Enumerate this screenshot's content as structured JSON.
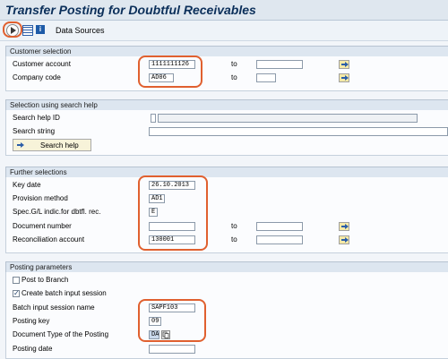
{
  "window": {
    "title": "Transfer Posting for Doubtful Receivables"
  },
  "toolbar": {
    "data_sources_label": "Data Sources"
  },
  "customer_selection": {
    "header": "Customer selection",
    "customer_account": {
      "label": "Customer account",
      "value": "1111111126",
      "to_label": "to",
      "to_value": ""
    },
    "company_code": {
      "label": "Company code",
      "value": "AD06",
      "to_label": "to",
      "to_value": ""
    }
  },
  "search_help": {
    "header": "Selection using search help",
    "search_help_id": {
      "label": "Search help ID",
      "value": ""
    },
    "search_string": {
      "label": "Search string",
      "value": ""
    },
    "button_label": "Search help"
  },
  "further_selections": {
    "header": "Further selections",
    "key_date": {
      "label": "Key date",
      "value": "26.10.2013"
    },
    "provision_method": {
      "label": "Provision method",
      "value": "AD1"
    },
    "special_gl": {
      "label": "Spec.G/L indic.for dbtfl. rec.",
      "value": "E"
    },
    "document_number": {
      "label": "Document number",
      "value": "",
      "to_label": "to",
      "to_value": ""
    },
    "reconciliation_account": {
      "label": "Reconciliation account",
      "value": "130001",
      "to_label": "to",
      "to_value": ""
    }
  },
  "posting_parameters": {
    "header": "Posting parameters",
    "post_to_branch": {
      "label": "Post to Branch",
      "checked": false
    },
    "create_batch_input": {
      "label": "Create batch input session",
      "checked": true
    },
    "batch_session_name": {
      "label": "Batch input session name",
      "value": "SAPF103"
    },
    "posting_key": {
      "label": "Posting key",
      "value": "09"
    },
    "document_type": {
      "label": "Document Type of the Posting",
      "value": "DA"
    },
    "posting_date": {
      "label": "Posting date",
      "value": ""
    }
  },
  "colors": {
    "annotation": "#e0602f",
    "title": "#0b2f5a",
    "section_header": "#dde6f0"
  }
}
